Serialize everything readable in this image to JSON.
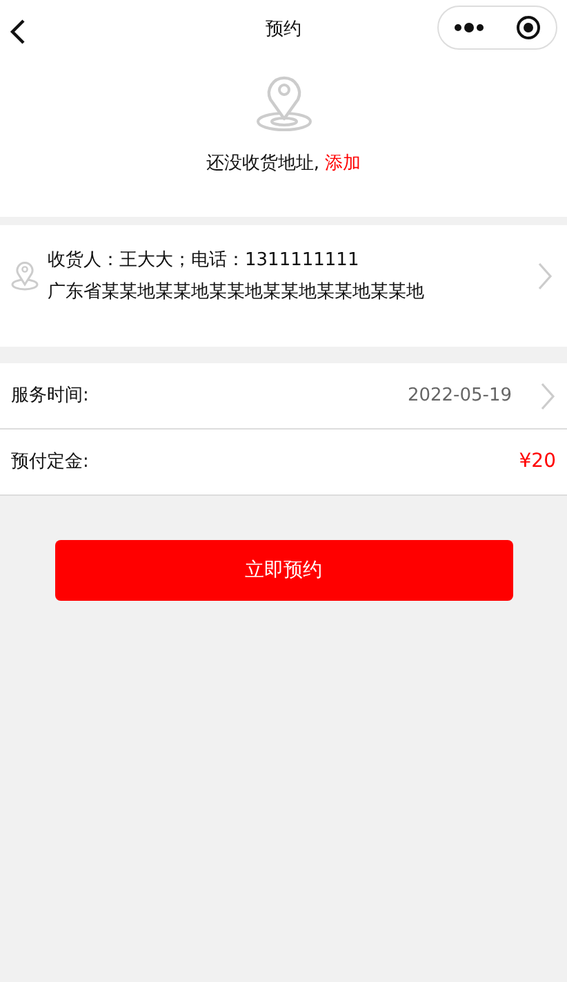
{
  "nav": {
    "title": "预约"
  },
  "empty_address": {
    "message": "还没收货地址,",
    "link": "添加"
  },
  "address": {
    "contact": "收货人：王大大；电话：1311111111",
    "detail": "广东省某某地某某地某某地某某地某某地某某地"
  },
  "fields": [
    {
      "kind": "date",
      "label": "服务时间:",
      "value": "2022-05-19"
    },
    {
      "kind": "price",
      "label": "预付定金:",
      "value": "¥20"
    }
  ],
  "submit_button": "立即预约"
}
